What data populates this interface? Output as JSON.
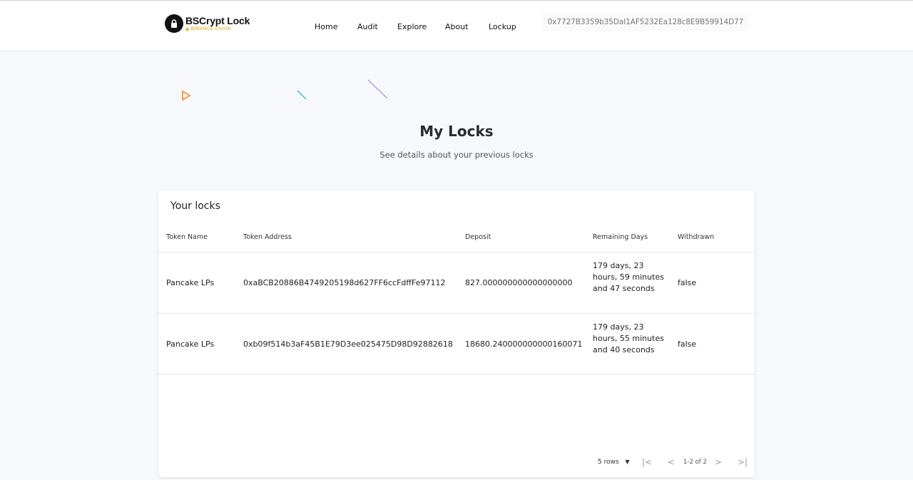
{
  "header": {
    "brand_title": "BSCrypt Lock",
    "brand_sub": "BINANCE CHAIN",
    "nav": [
      "Home",
      "Audit",
      "Explore",
      "About",
      "Lockup"
    ],
    "wallet_address": "0x7727B3359b35DaI1AF5232Ea128c8E9B59914D77"
  },
  "page": {
    "title": "My Locks",
    "subtitle": "See details about your previous locks"
  },
  "table": {
    "title": "Your locks",
    "columns": [
      "Token Name",
      "Token Address",
      "Deposit",
      "Remaining Days",
      "Withdrawn"
    ],
    "rows": [
      {
        "token_name": "Pancake LPs",
        "token_address": "0xaBCB20886B4749205198d627FF6ccFdffFe97112",
        "deposit": "827.000000000000000000",
        "remaining": "179 days, 23 hours, 59 minutes and 47 seconds",
        "withdrawn": "false"
      },
      {
        "token_name": "Pancake LPs",
        "token_address": "0xb09f514b3aF45B1E79D3ee025475D98D92882618",
        "deposit": "18680.240000000000160071",
        "remaining": "179 days, 23 hours, 55 minutes and 40 seconds",
        "withdrawn": "false"
      }
    ],
    "rows_per_page": "5 rows",
    "page_info": "1-2 of 2"
  },
  "colors": {
    "accent_triangle": "#f0a04a",
    "accent_line_teal": "#3cc6c9",
    "accent_line_purple": "#a9a3d9",
    "brand_gold": "#e8b93a"
  },
  "icons": [
    "lock-icon",
    "bnb-icon",
    "chevron-down-icon",
    "first-page-icon",
    "prev-page-icon",
    "next-page-icon",
    "last-page-icon"
  ]
}
